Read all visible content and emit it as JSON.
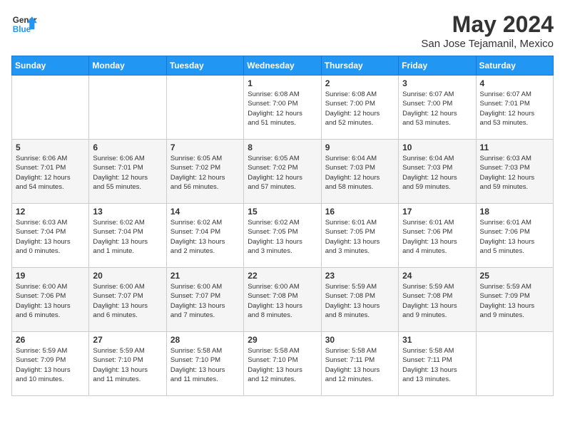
{
  "logo": {
    "line1": "General",
    "line2": "Blue"
  },
  "title": "May 2024",
  "location": "San Jose Tejamanil, Mexico",
  "days_of_week": [
    "Sunday",
    "Monday",
    "Tuesday",
    "Wednesday",
    "Thursday",
    "Friday",
    "Saturday"
  ],
  "weeks": [
    [
      {
        "day": "",
        "content": ""
      },
      {
        "day": "",
        "content": ""
      },
      {
        "day": "",
        "content": ""
      },
      {
        "day": "1",
        "content": "Sunrise: 6:08 AM\nSunset: 7:00 PM\nDaylight: 12 hours\nand 51 minutes."
      },
      {
        "day": "2",
        "content": "Sunrise: 6:08 AM\nSunset: 7:00 PM\nDaylight: 12 hours\nand 52 minutes."
      },
      {
        "day": "3",
        "content": "Sunrise: 6:07 AM\nSunset: 7:00 PM\nDaylight: 12 hours\nand 53 minutes."
      },
      {
        "day": "4",
        "content": "Sunrise: 6:07 AM\nSunset: 7:01 PM\nDaylight: 12 hours\nand 53 minutes."
      }
    ],
    [
      {
        "day": "5",
        "content": "Sunrise: 6:06 AM\nSunset: 7:01 PM\nDaylight: 12 hours\nand 54 minutes."
      },
      {
        "day": "6",
        "content": "Sunrise: 6:06 AM\nSunset: 7:01 PM\nDaylight: 12 hours\nand 55 minutes."
      },
      {
        "day": "7",
        "content": "Sunrise: 6:05 AM\nSunset: 7:02 PM\nDaylight: 12 hours\nand 56 minutes."
      },
      {
        "day": "8",
        "content": "Sunrise: 6:05 AM\nSunset: 7:02 PM\nDaylight: 12 hours\nand 57 minutes."
      },
      {
        "day": "9",
        "content": "Sunrise: 6:04 AM\nSunset: 7:03 PM\nDaylight: 12 hours\nand 58 minutes."
      },
      {
        "day": "10",
        "content": "Sunrise: 6:04 AM\nSunset: 7:03 PM\nDaylight: 12 hours\nand 59 minutes."
      },
      {
        "day": "11",
        "content": "Sunrise: 6:03 AM\nSunset: 7:03 PM\nDaylight: 12 hours\nand 59 minutes."
      }
    ],
    [
      {
        "day": "12",
        "content": "Sunrise: 6:03 AM\nSunset: 7:04 PM\nDaylight: 13 hours\nand 0 minutes."
      },
      {
        "day": "13",
        "content": "Sunrise: 6:02 AM\nSunset: 7:04 PM\nDaylight: 13 hours\nand 1 minute."
      },
      {
        "day": "14",
        "content": "Sunrise: 6:02 AM\nSunset: 7:04 PM\nDaylight: 13 hours\nand 2 minutes."
      },
      {
        "day": "15",
        "content": "Sunrise: 6:02 AM\nSunset: 7:05 PM\nDaylight: 13 hours\nand 3 minutes."
      },
      {
        "day": "16",
        "content": "Sunrise: 6:01 AM\nSunset: 7:05 PM\nDaylight: 13 hours\nand 3 minutes."
      },
      {
        "day": "17",
        "content": "Sunrise: 6:01 AM\nSunset: 7:06 PM\nDaylight: 13 hours\nand 4 minutes."
      },
      {
        "day": "18",
        "content": "Sunrise: 6:01 AM\nSunset: 7:06 PM\nDaylight: 13 hours\nand 5 minutes."
      }
    ],
    [
      {
        "day": "19",
        "content": "Sunrise: 6:00 AM\nSunset: 7:06 PM\nDaylight: 13 hours\nand 6 minutes."
      },
      {
        "day": "20",
        "content": "Sunrise: 6:00 AM\nSunset: 7:07 PM\nDaylight: 13 hours\nand 6 minutes."
      },
      {
        "day": "21",
        "content": "Sunrise: 6:00 AM\nSunset: 7:07 PM\nDaylight: 13 hours\nand 7 minutes."
      },
      {
        "day": "22",
        "content": "Sunrise: 6:00 AM\nSunset: 7:08 PM\nDaylight: 13 hours\nand 8 minutes."
      },
      {
        "day": "23",
        "content": "Sunrise: 5:59 AM\nSunset: 7:08 PM\nDaylight: 13 hours\nand 8 minutes."
      },
      {
        "day": "24",
        "content": "Sunrise: 5:59 AM\nSunset: 7:08 PM\nDaylight: 13 hours\nand 9 minutes."
      },
      {
        "day": "25",
        "content": "Sunrise: 5:59 AM\nSunset: 7:09 PM\nDaylight: 13 hours\nand 9 minutes."
      }
    ],
    [
      {
        "day": "26",
        "content": "Sunrise: 5:59 AM\nSunset: 7:09 PM\nDaylight: 13 hours\nand 10 minutes."
      },
      {
        "day": "27",
        "content": "Sunrise: 5:59 AM\nSunset: 7:10 PM\nDaylight: 13 hours\nand 11 minutes."
      },
      {
        "day": "28",
        "content": "Sunrise: 5:58 AM\nSunset: 7:10 PM\nDaylight: 13 hours\nand 11 minutes."
      },
      {
        "day": "29",
        "content": "Sunrise: 5:58 AM\nSunset: 7:10 PM\nDaylight: 13 hours\nand 12 minutes."
      },
      {
        "day": "30",
        "content": "Sunrise: 5:58 AM\nSunset: 7:11 PM\nDaylight: 13 hours\nand 12 minutes."
      },
      {
        "day": "31",
        "content": "Sunrise: 5:58 AM\nSunset: 7:11 PM\nDaylight: 13 hours\nand 13 minutes."
      },
      {
        "day": "",
        "content": ""
      }
    ]
  ]
}
